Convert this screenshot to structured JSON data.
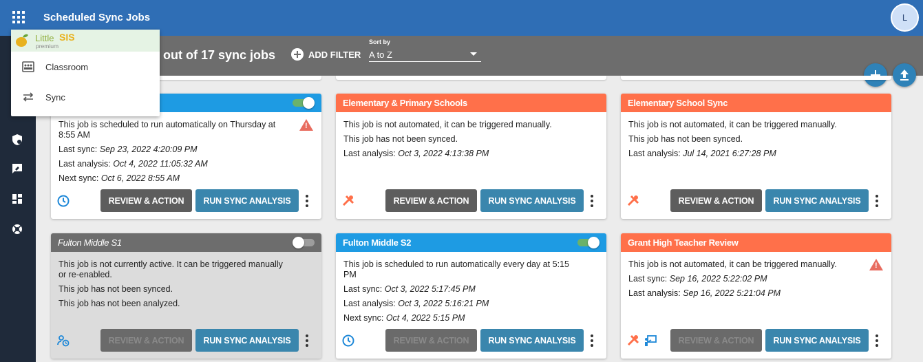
{
  "header": {
    "title": "Scheduled Sync Jobs",
    "avatar_initial": "L"
  },
  "filterbar": {
    "count_text": "7 out of 17 sync jobs",
    "add_filter": "ADD FILTER",
    "sort_label": "Sort by",
    "sort_value": "A to Z"
  },
  "app_menu": {
    "brand_little": "Little",
    "brand_sis": "SIS",
    "brand_tier": "premium",
    "items": [
      {
        "label": "Classroom",
        "icon": "classroom-icon"
      },
      {
        "label": "Sync",
        "icon": "sync-arrows-icon"
      }
    ]
  },
  "buttons": {
    "review": "REVIEW & ACTION",
    "run": "RUN SYNC ANALYSIS"
  },
  "colors": {
    "automated": "#1e9be3",
    "manual": "#ff704a",
    "inactive": "#6d6d6d",
    "run_button": "#3a86ad",
    "review_button": "#5d5d5d",
    "topbar": "#2f6eb5"
  },
  "cards": [
    {
      "title": "",
      "lines": [
        {
          "text": "This job is scheduled to run automatically on Thursday at 8:55 AM",
          "value": ""
        },
        {
          "text": "Last sync: ",
          "value": "Sep 23, 2022 4:20:09 PM"
        },
        {
          "text": "Last analysis: ",
          "value": "Oct 4, 2022 11:05:32 AM"
        },
        {
          "text": "Next sync: ",
          "value": "Oct 6, 2022 8:55 AM"
        }
      ]
    },
    {
      "title": "Elementary & Primary Schools",
      "lines": [
        {
          "text": "This job is not automated, it can be triggered manually.",
          "value": ""
        },
        {
          "text": "This job has not been synced.",
          "value": ""
        },
        {
          "text": "Last analysis: ",
          "value": "Oct 3, 2022 4:13:38 PM"
        }
      ]
    },
    {
      "title": "Elementary School Sync",
      "lines": [
        {
          "text": "This job is not automated, it can be triggered manually.",
          "value": ""
        },
        {
          "text": "This job has not been synced.",
          "value": ""
        },
        {
          "text": "Last analysis: ",
          "value": "Jul 14, 2021 6:27:28 PM"
        }
      ]
    },
    {
      "title": "Fulton Middle S1",
      "lines": [
        {
          "text": "This job is not currently active. It can be triggered manually or re-enabled.",
          "value": ""
        },
        {
          "text": "This job has not been synced.",
          "value": ""
        },
        {
          "text": "This job has not been analyzed.",
          "value": ""
        }
      ]
    },
    {
      "title": "Fulton Middle S2",
      "lines": [
        {
          "text": "This job is scheduled to run automatically every day at 5:15 PM",
          "value": ""
        },
        {
          "text": "Last sync: ",
          "value": "Oct 3, 2022 5:17:45 PM"
        },
        {
          "text": "Last analysis: ",
          "value": "Oct 3, 2022 5:16:21 PM"
        },
        {
          "text": "Next sync: ",
          "value": "Oct 4, 2022 5:15 PM"
        }
      ]
    },
    {
      "title": "Grant High Teacher Review",
      "lines": [
        {
          "text": "This job is not automated, it can be triggered manually.",
          "value": ""
        },
        {
          "text": "Last sync: ",
          "value": "Sep 16, 2022 5:22:02 PM"
        },
        {
          "text": "Last analysis: ",
          "value": "Sep 16, 2022 5:21:04 PM"
        }
      ]
    }
  ]
}
